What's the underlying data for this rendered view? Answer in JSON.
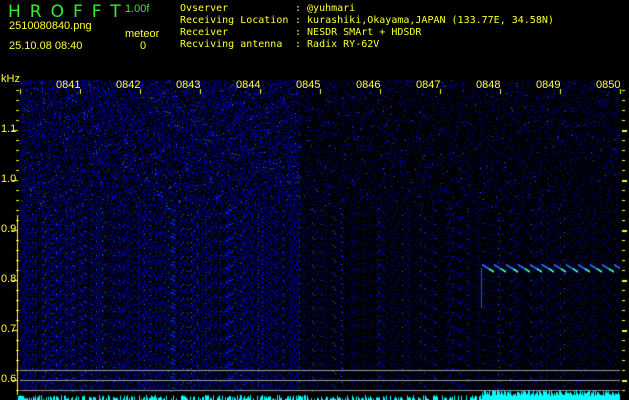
{
  "header": {
    "brand": "HROFFT",
    "version": "1.00f",
    "filename": "2510080840.png",
    "datetime": "25.10.08 08:40",
    "meteor_label": "meteor",
    "meteor_count": "0"
  },
  "info": [
    {
      "label": "Ovserver",
      "value": ": @yuhmari"
    },
    {
      "label": "Receiving Location",
      "value": ": kurashiki,Okayama,JAPAN (133.77E, 34.58N)"
    },
    {
      "label": "Receiver",
      "value": ": NESDR SMArt + HDSDR"
    },
    {
      "label": "Recviving antenna",
      "value": ": Radix RY-62V"
    }
  ],
  "axis": {
    "unit": "kHz",
    "time_labels": [
      "0841",
      "0842",
      "0843",
      "0844",
      "0845",
      "0846",
      "0847",
      "0848",
      "0849",
      "0850"
    ],
    "freq_labels": [
      "1.1",
      "1.0",
      "0.9",
      "0.8",
      "0.7",
      "0.6"
    ]
  },
  "colors": {
    "text": "#ffff33",
    "brand": "#33ee33",
    "noise": "#1a1aff",
    "level": "#00ffff"
  }
}
